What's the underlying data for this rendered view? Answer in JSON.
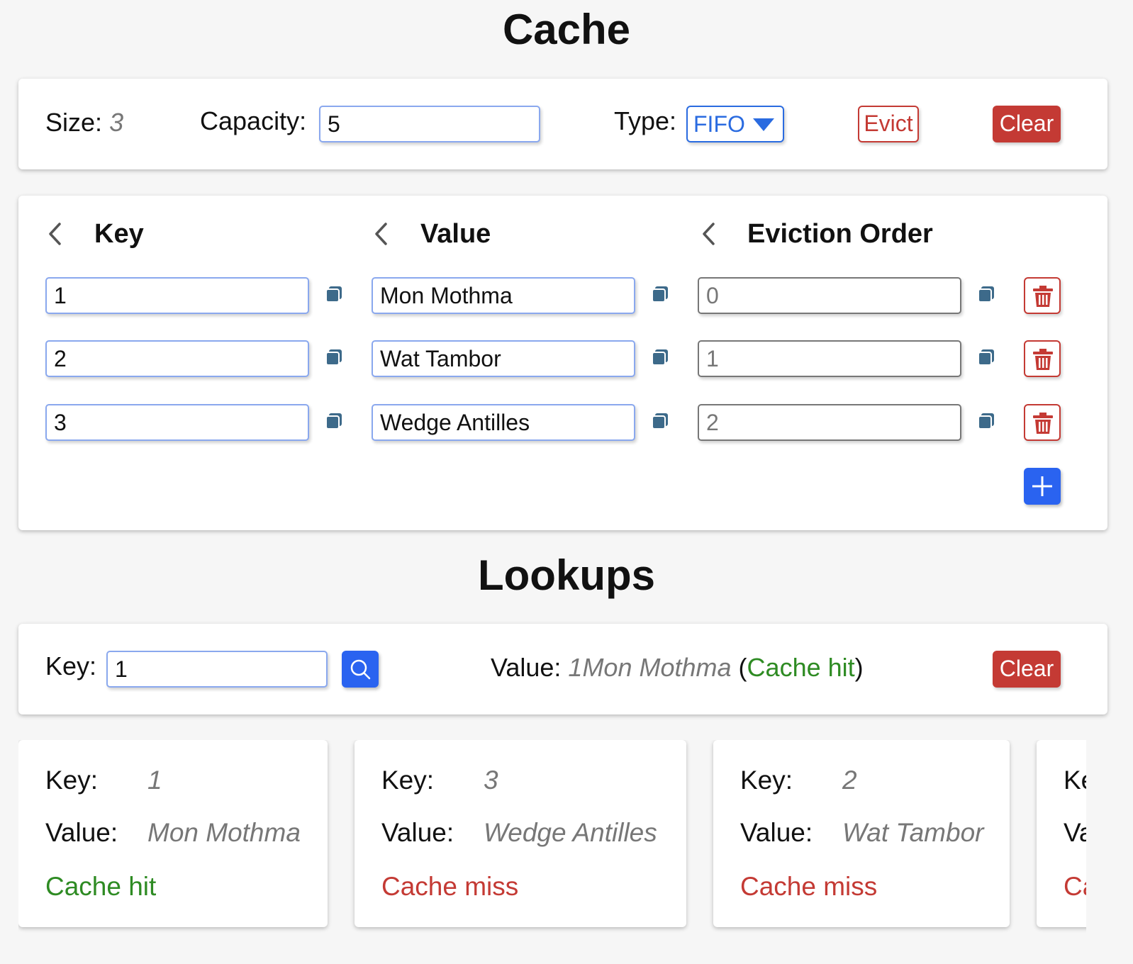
{
  "cache_title": "Cache",
  "controls": {
    "size_label": "Size:",
    "size_value": "3",
    "capacity_label": "Capacity:",
    "capacity_value": "5",
    "type_label": "Type:",
    "type_value": "FIFO",
    "evict_label": "Evict",
    "clear_label": "Clear"
  },
  "table": {
    "headers": [
      "Key",
      "Value",
      "Eviction Order"
    ],
    "rows": [
      {
        "key": "1",
        "value": "Mon Mothma",
        "order": "0"
      },
      {
        "key": "2",
        "value": "Wat Tambor",
        "order": "1"
      },
      {
        "key": "3",
        "value": "Wedge Antilles",
        "order": "2"
      }
    ]
  },
  "lookups_title": "Lookups",
  "lookup": {
    "key_label": "Key:",
    "key_value": "1",
    "value_label": "Value:",
    "result_value": "1Mon Mothma",
    "open_paren": "(",
    "result_status": "Cache hit",
    "close_paren": ")",
    "clear_label": "Clear"
  },
  "history": [
    {
      "key_label": "Key:",
      "key": "1",
      "value_label": "Value:",
      "value": "Mon Mothma",
      "status": "Cache hit",
      "hit": true
    },
    {
      "key_label": "Key:",
      "key": "3",
      "value_label": "Value:",
      "value": "Wedge Antilles",
      "status": "Cache miss",
      "hit": false
    },
    {
      "key_label": "Key:",
      "key": "2",
      "value_label": "Value:",
      "value": "Wat Tambor",
      "status": "Cache miss",
      "hit": false
    },
    {
      "key_label": "Key:",
      "key": "",
      "value_label": "Value:",
      "value": "",
      "status": "Cache miss",
      "hit": false
    }
  ],
  "colors": {
    "accent": "#2a63f0",
    "danger": "#c43a34",
    "hit": "#2e8b23",
    "copy_icon": "#3d6a8a"
  },
  "icons": [
    "chevron-left-icon",
    "copy-icon",
    "trash-icon",
    "plus-icon",
    "search-icon",
    "caret-down-icon"
  ]
}
